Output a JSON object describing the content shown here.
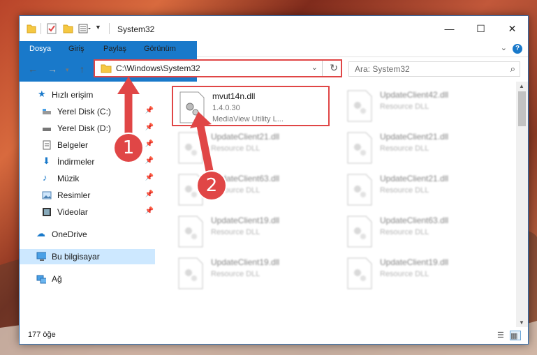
{
  "window": {
    "title": "System32",
    "ribbon_tabs": [
      "Dosya",
      "Giriş",
      "Paylaş",
      "Görünüm"
    ],
    "help_label": "?"
  },
  "address_bar": {
    "path": "C:\\Windows\\System32"
  },
  "search": {
    "placeholder": "Ara: System32"
  },
  "nav": {
    "quick_access": "Hızlı erişim",
    "items": [
      {
        "label": "Yerel Disk (C:)",
        "icon": "drive-icon",
        "pinned": true
      },
      {
        "label": "Yerel Disk (D:)",
        "icon": "drive-icon",
        "pinned": true
      },
      {
        "label": "Belgeler",
        "icon": "documents-icon",
        "pinned": true
      },
      {
        "label": "İndirmeler",
        "icon": "download-icon",
        "pinned": true
      },
      {
        "label": "Müzik",
        "icon": "music-icon",
        "pinned": true
      },
      {
        "label": "Resimler",
        "icon": "pictures-icon",
        "pinned": true
      },
      {
        "label": "Videolar",
        "icon": "video-icon",
        "pinned": true
      }
    ],
    "onedrive": "OneDrive",
    "this_pc": "Bu bilgisayar",
    "network": "Ağ"
  },
  "files": [
    {
      "name": "mvut14n.dll",
      "line2": "1.4.0.30",
      "line3": "MediaView Utility L...",
      "highlight": true
    },
    {
      "name": "UpdateClient42.dll",
      "line2": "Resource DLL",
      "line3": ""
    },
    {
      "name": "UpdateClient21.dll",
      "line2": "Resource DLL",
      "line3": ""
    },
    {
      "name": "UpdateClient21.dll",
      "line2": "Resource DLL",
      "line3": ""
    },
    {
      "name": "UpdateClient63.dll",
      "line2": "Resource DLL",
      "line3": ""
    },
    {
      "name": "UpdateClient21.dll",
      "line2": "Resource DLL",
      "line3": ""
    },
    {
      "name": "UpdateClient19.dll",
      "line2": "Resource DLL",
      "line3": ""
    },
    {
      "name": "UpdateClient63.dll",
      "line2": "Resource DLL",
      "line3": ""
    },
    {
      "name": "UpdateClient19.dll",
      "line2": "Resource DLL",
      "line3": ""
    },
    {
      "name": "UpdateClient19.dll",
      "line2": "Resource DLL",
      "line3": ""
    }
  ],
  "status": {
    "item_count": "177 öğe"
  },
  "annotations": {
    "badge1": "1",
    "badge2": "2"
  },
  "colors": {
    "accent": "#1979ca",
    "highlight": "#e04646",
    "selected": "#cde8ff"
  }
}
